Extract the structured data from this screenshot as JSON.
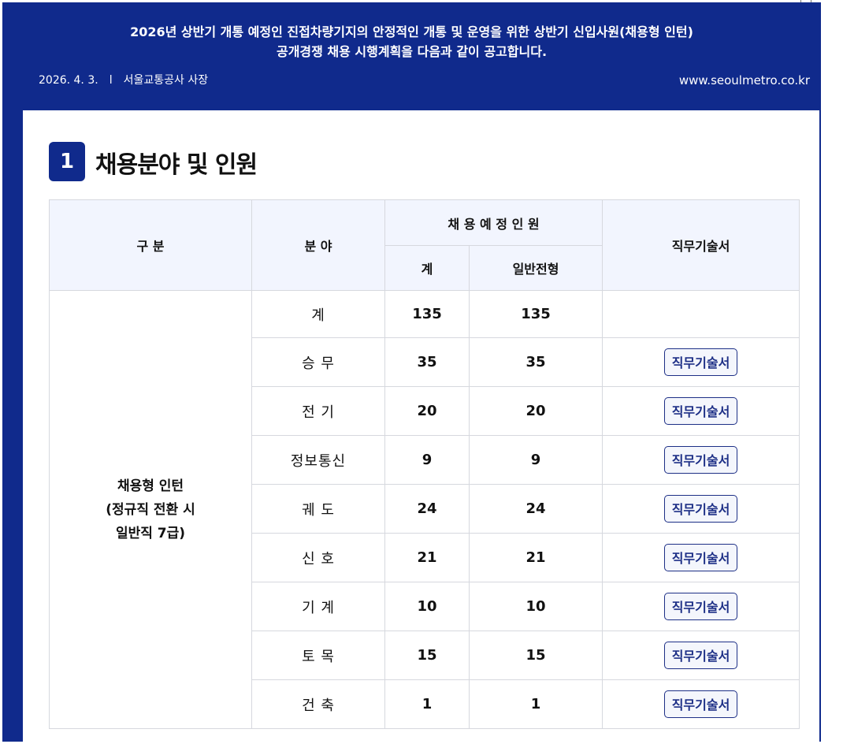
{
  "header": {
    "line1": "2026년 상반기 개통 예정인 진접차량기지의 안정적인 개통 및 운영을 위한 상반기 신입사원(채용형 인턴)",
    "line2": "공개경쟁 채용 시행계획을  다음과 같이 공고합니다.",
    "date": "2026. 4. 3.",
    "separator": "l",
    "issuer": "서울교통공사 사장",
    "url": "www.seoulmetro.co.kr"
  },
  "section": {
    "number": "1",
    "title": "채용분야 및 인원"
  },
  "table": {
    "headers": {
      "category": "구 분",
      "field": "분 야",
      "planned": "채 용 예 정 인 원",
      "total": "계",
      "general": "일반전형",
      "jobdoc": "직무기술서"
    },
    "group": {
      "line1": "채용형 인턴",
      "line2": "(정규직 전환 시",
      "line3": "일반직 7급)"
    },
    "rows": [
      {
        "field": "계",
        "total": "135",
        "general": "135",
        "doc": ""
      },
      {
        "field": "승 무",
        "total": "35",
        "general": "35",
        "doc": "직무기술서"
      },
      {
        "field": "전 기",
        "total": "20",
        "general": "20",
        "doc": "직무기술서"
      },
      {
        "field": "정보통신",
        "total": "9",
        "general": "9",
        "doc": "직무기술서"
      },
      {
        "field": "궤 도",
        "total": "24",
        "general": "24",
        "doc": "직무기술서"
      },
      {
        "field": "신 호",
        "total": "21",
        "general": "21",
        "doc": "직무기술서"
      },
      {
        "field": "기 계",
        "total": "10",
        "general": "10",
        "doc": "직무기술서"
      },
      {
        "field": "토 목",
        "total": "15",
        "general": "15",
        "doc": "직무기술서"
      },
      {
        "field": "건 축",
        "total": "1",
        "general": "1",
        "doc": "직무기술서"
      }
    ]
  },
  "colors": {
    "brand": "#102a8c",
    "header_bg": "#f2f5fe",
    "border": "#d6d8de"
  }
}
